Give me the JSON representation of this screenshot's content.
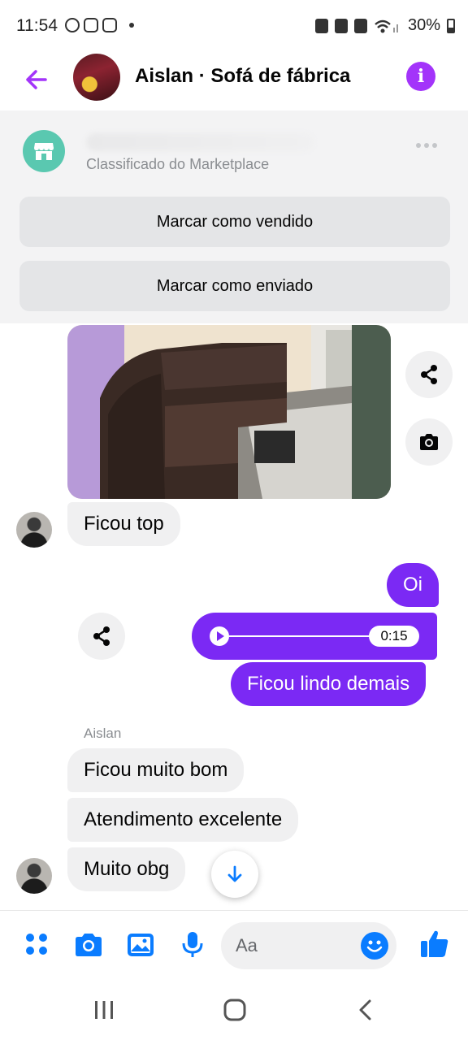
{
  "status_bar": {
    "time": "11:54",
    "battery": "30%"
  },
  "header": {
    "title": "Aislan · Sofá de fábrica",
    "info_label": "i"
  },
  "marketplace": {
    "subtitle": "Classificado do Marketplace",
    "mark_sold_label": "Marcar como vendido",
    "mark_shipped_label": "Marcar como enviado"
  },
  "messages": {
    "m1": "Ficou top",
    "m2": "Oi",
    "audio_duration": "0:15",
    "m3": "Ficou lindo demais",
    "sender_name": "Aislan",
    "m4": "Ficou muito bom",
    "m5": "Atendimento excelente",
    "m6": "Muito obg"
  },
  "composer": {
    "placeholder": "Aa"
  },
  "colors": {
    "accent": "#7b29f4",
    "messenger_blue": "#0a7cff",
    "info_purple": "#a334fa",
    "incoming_bubble": "#f0f0f1"
  }
}
